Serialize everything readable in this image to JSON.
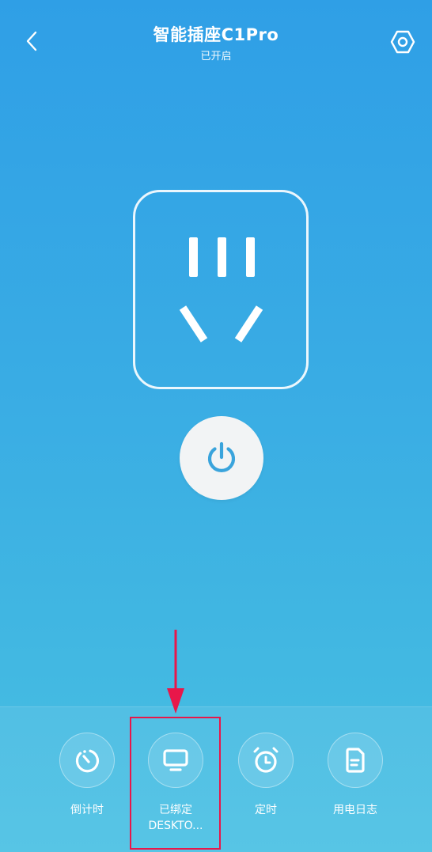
{
  "header": {
    "title": "智能插座C1Pro",
    "status": "已开启",
    "back_icon": "chevron-left-icon",
    "settings_icon": "settings-hexagon-icon"
  },
  "main": {
    "socket_icon": "power-outlet-icon",
    "power_icon": "power-icon",
    "power_icon_color": "#3aa4dc"
  },
  "bottom_bar": {
    "items": [
      {
        "label": "倒计时",
        "icon": "countdown-timer-icon"
      },
      {
        "label": "已绑定",
        "sublabel": "DESKTO...",
        "icon": "monitor-icon"
      },
      {
        "label": "定时",
        "icon": "alarm-clock-icon"
      },
      {
        "label": "用电日志",
        "icon": "document-log-icon"
      }
    ]
  },
  "annotation": {
    "color": "#e8174a"
  },
  "colors": {
    "background_top": "#2f9fe6",
    "background_bottom": "#49c0e3",
    "foreground": "#ffffff"
  }
}
